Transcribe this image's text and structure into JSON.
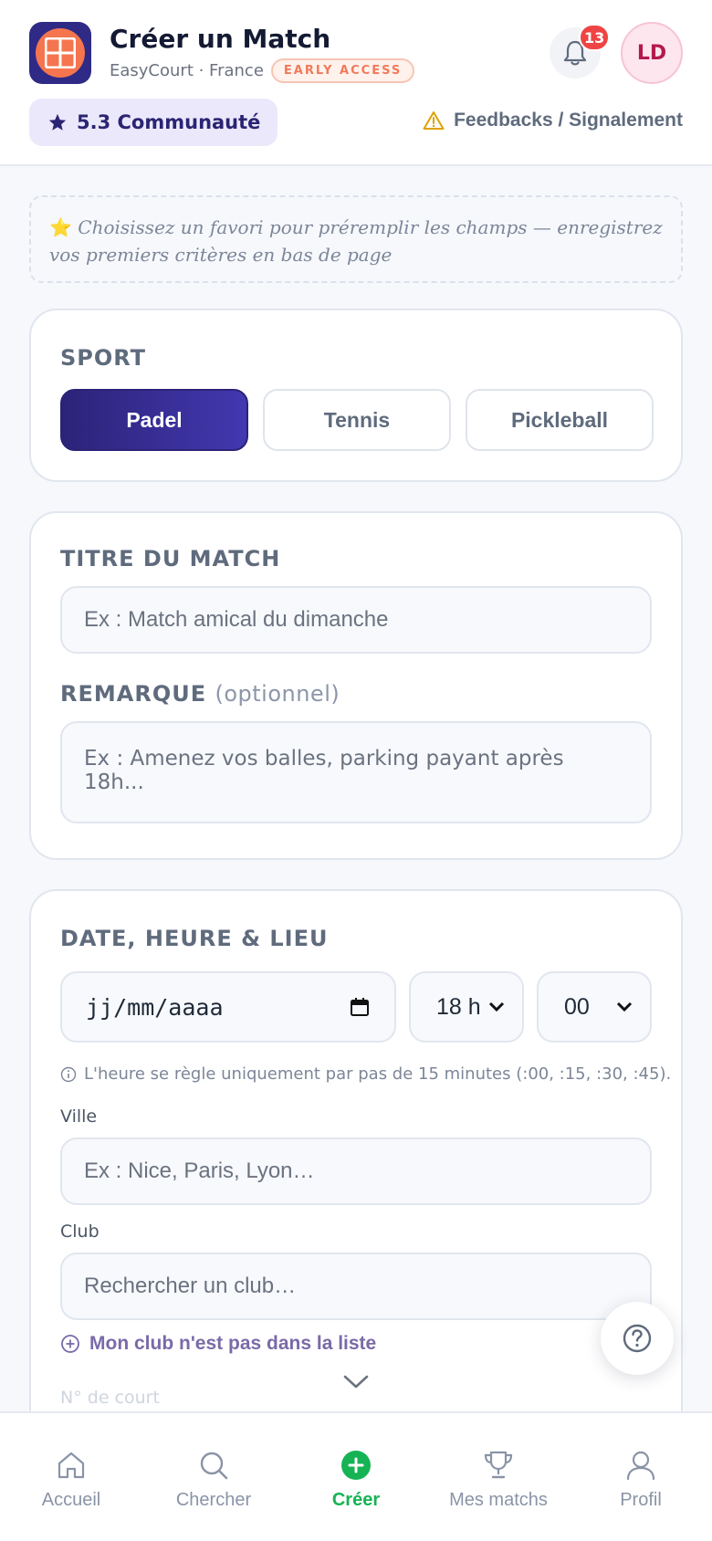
{
  "header": {
    "title": "Créer un Match",
    "subtitle": "EasyCourt · France",
    "badge": "EARLY ACCESS",
    "notification_count": "13",
    "avatar_initials": "LD",
    "community_label": "5.3 Communauté",
    "feedback_label": "Feedbacks / Signalement"
  },
  "hint": {
    "emoji": "⭐",
    "text": "Choisissez un favori pour préremplir les champs — enregistrez vos premiers critères en bas de page"
  },
  "sport": {
    "title": "SPORT",
    "options": [
      "Padel",
      "Tennis",
      "Pickleball"
    ],
    "selected": "Padel"
  },
  "match": {
    "title_label": "TITRE DU MATCH",
    "title_placeholder": "Ex : Match amical du dimanche",
    "remark_label": "REMARQUE",
    "remark_optional": "(optionnel)",
    "remark_placeholder": "Ex : Amenez vos balles, parking payant après 18h..."
  },
  "schedule": {
    "title": "DATE, HEURE & LIEU",
    "date_placeholder": "jj/mm/aaaa",
    "hour_value": "18 h",
    "minute_value": "00",
    "note": "L'heure se règle uniquement par pas de 15 minutes (:00, :15, :30, :45).",
    "city_label": "Ville",
    "city_placeholder": "Ex : Nice, Paris, Lyon…",
    "club_label": "Club",
    "club_placeholder": "Rechercher un club…",
    "add_club_label": "Mon club n'est pas dans la liste",
    "court_label": "N° de court"
  },
  "nav": {
    "items": [
      {
        "label": "Accueil",
        "icon": "home-icon"
      },
      {
        "label": "Chercher",
        "icon": "search-icon"
      },
      {
        "label": "Créer",
        "icon": "plus-circle-icon"
      },
      {
        "label": "Mes matchs",
        "icon": "trophy-icon"
      },
      {
        "label": "Profil",
        "icon": "user-icon"
      }
    ],
    "active": "Créer"
  },
  "colors": {
    "primary": "#2c2378",
    "accent_orange": "#f5754f",
    "active_green": "#16b354",
    "badge_red": "#ef4444"
  }
}
